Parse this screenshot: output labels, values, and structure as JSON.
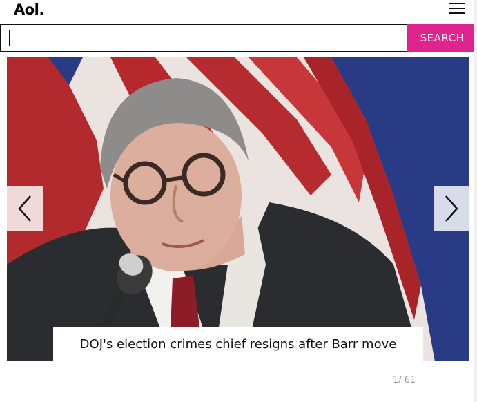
{
  "header": {
    "logo": "Aol.",
    "menu_icon": "hamburger-menu-icon"
  },
  "search": {
    "value": "",
    "placeholder": "",
    "button_label": "SEARCH",
    "accent_color": "#e0248f"
  },
  "slideshow": {
    "image_description_icon": "photo",
    "caption": "DOJ's election crimes chief resigns after Barr move",
    "counter": "1/ 61",
    "prev_icon": "chevron-left-icon",
    "next_icon": "chevron-right-icon"
  }
}
